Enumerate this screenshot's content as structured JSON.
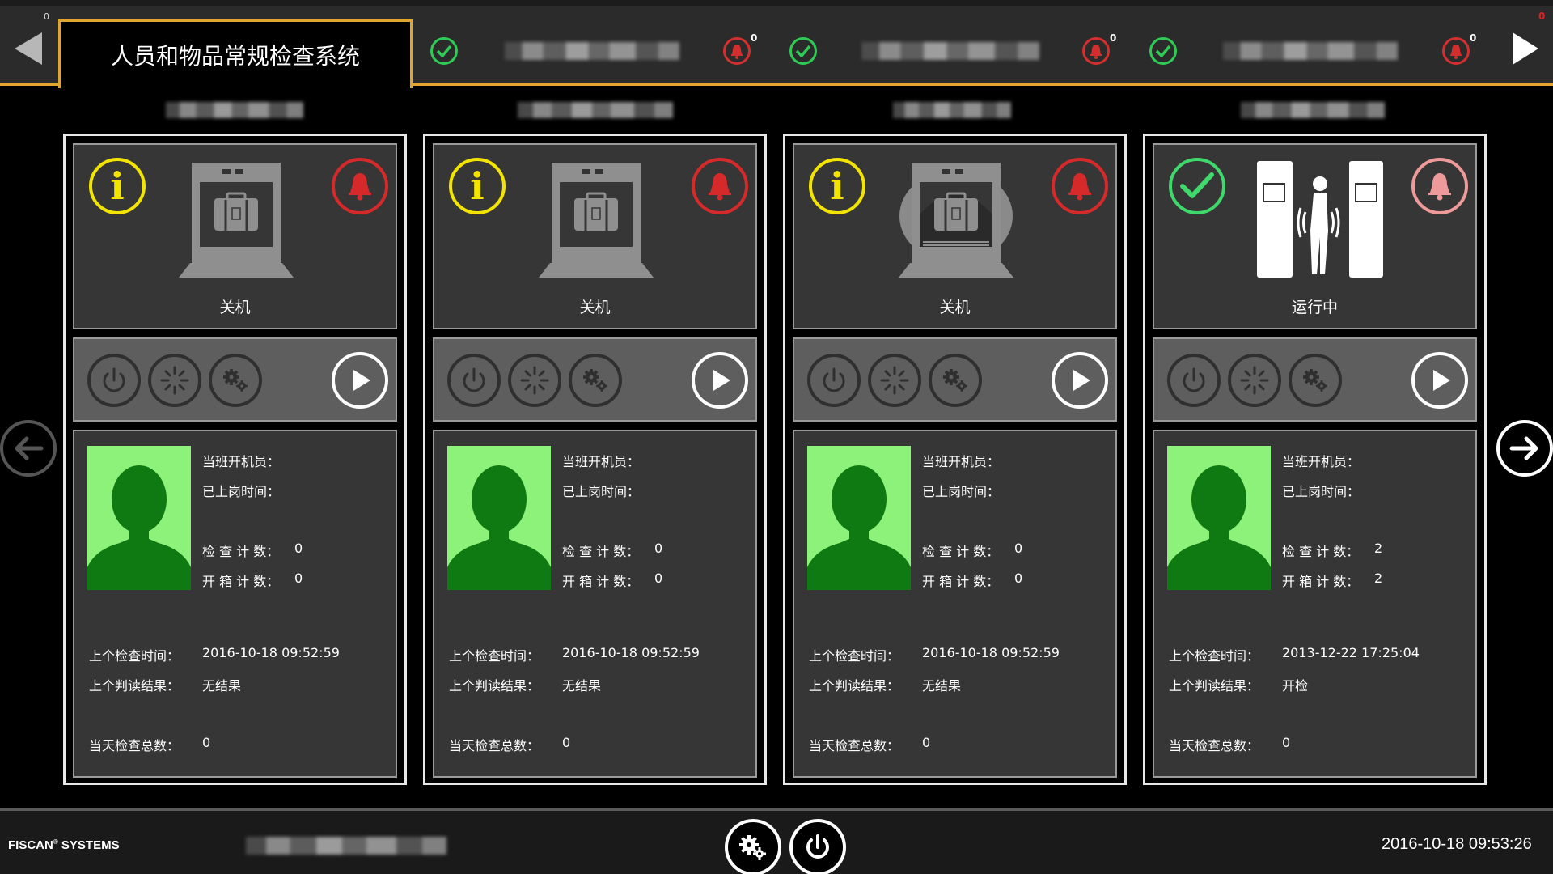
{
  "app": {
    "title": "人员和物品常规检查系统",
    "top_counter": "0",
    "top_red_counter": "0"
  },
  "topbar": {
    "groups": [
      {
        "alarm_count": "0"
      },
      {
        "alarm_count": "0"
      },
      {
        "alarm_count": "0"
      }
    ]
  },
  "labels": {
    "operator": "当班开机员：",
    "on_duty": "已上岗时间：",
    "check_count": "检 查 计 数：",
    "open_count": "开 箱 计 数：",
    "last_check_time": "上个检查时间：",
    "last_result": "上个判读结果：",
    "day_total": "当天检查总数："
  },
  "cards": [
    {
      "machine": "xray-machine",
      "status": "关机",
      "check_count": "0",
      "open_count": "0",
      "last_check_time": "2016-10-18 09:52:59",
      "last_result": "无结果",
      "day_total": "0",
      "state_icon": "info-icon",
      "alarm_color": "#d62a2a"
    },
    {
      "machine": "xray-machine",
      "status": "关机",
      "check_count": "0",
      "open_count": "0",
      "last_check_time": "2016-10-18 09:52:59",
      "last_result": "无结果",
      "day_total": "0",
      "state_icon": "info-icon",
      "alarm_color": "#d62a2a"
    },
    {
      "machine": "xray-tunnel-machine",
      "status": "关机",
      "check_count": "0",
      "open_count": "0",
      "last_check_time": "2016-10-18 09:52:59",
      "last_result": "无结果",
      "day_total": "0",
      "state_icon": "info-icon",
      "alarm_color": "#d62a2a"
    },
    {
      "machine": "body-scanner",
      "status": "运行中",
      "check_count": "2",
      "open_count": "2",
      "last_check_time": "2013-12-22 17:25:04",
      "last_result": "开检",
      "day_total": "0",
      "state_icon": "ok-icon",
      "alarm_color": "#ef9a9a"
    }
  ],
  "footer": {
    "brand_name": "FISCAN",
    "brand_reg": "®",
    "brand_suffix": "SYSTEMS",
    "datetime": "2016-10-18 09:53:26"
  },
  "colors": {
    "accent": "#e2a52d",
    "ok": "#2ecc55",
    "alarm": "#d62a2a",
    "info": "#f3e400",
    "photo_bg": "#8cf27a",
    "silhouette": "#0f7a12"
  }
}
